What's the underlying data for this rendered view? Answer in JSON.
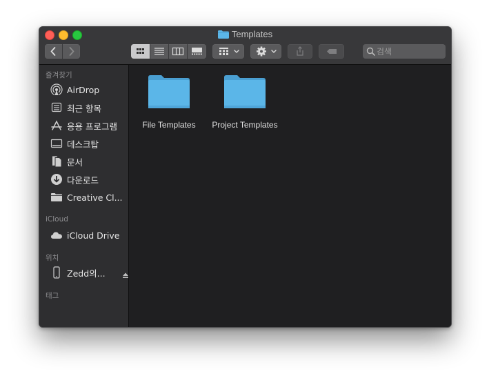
{
  "window": {
    "title": "Templates"
  },
  "toolbar": {
    "nav": [
      "back",
      "forward"
    ],
    "view_modes": [
      "icon-view",
      "list-view",
      "column-view",
      "gallery-view"
    ],
    "active_view": "icon-view",
    "group_by": "group-by",
    "action": "action-menu",
    "share": "share",
    "tag": "tag"
  },
  "search": {
    "placeholder": "검색"
  },
  "sidebar": {
    "favorites_header": "즐겨찾기",
    "favorites": [
      {
        "label": "AirDrop",
        "icon": "airdrop-icon"
      },
      {
        "label": "최근 항목",
        "icon": "recents-icon"
      },
      {
        "label": "응용 프로그램",
        "icon": "applications-icon"
      },
      {
        "label": "데스크탑",
        "icon": "desktop-icon"
      },
      {
        "label": "문서",
        "icon": "documents-icon"
      },
      {
        "label": "다운로드",
        "icon": "downloads-icon"
      },
      {
        "label": "Creative Cl...",
        "icon": "folder-icon"
      }
    ],
    "icloud_header": "iCloud",
    "icloud": [
      {
        "label": "iCloud Drive",
        "icon": "cloud-icon"
      }
    ],
    "locations_header": "위치",
    "locations": [
      {
        "label": "Zedd의...",
        "icon": "iphone-icon"
      }
    ],
    "tags_header": "태그"
  },
  "content": {
    "items": [
      {
        "name": "File Templates",
        "type": "folder"
      },
      {
        "name": "Project Templates",
        "type": "folder"
      }
    ]
  },
  "colors": {
    "folder": "#5bb6e8",
    "folder_tab": "#4a9fd2",
    "sidebar_bg": "#2e2e30",
    "content_bg": "#1f1f21",
    "titlebar_bg": "#38383a"
  }
}
